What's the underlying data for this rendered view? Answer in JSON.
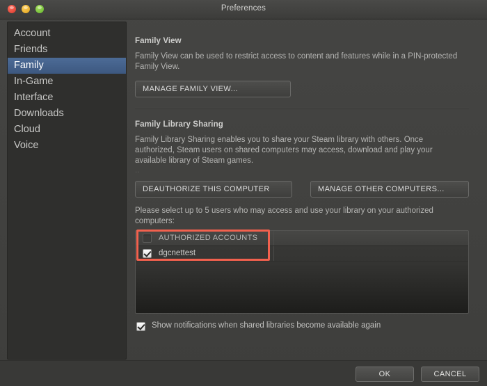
{
  "window": {
    "title": "Preferences",
    "traffic_lights": [
      "close",
      "minimize",
      "maximize"
    ]
  },
  "sidebar": {
    "items": [
      {
        "label": "Account",
        "selected": false
      },
      {
        "label": "Friends",
        "selected": false
      },
      {
        "label": "Family",
        "selected": true
      },
      {
        "label": "In-Game",
        "selected": false
      },
      {
        "label": "Interface",
        "selected": false
      },
      {
        "label": "Downloads",
        "selected": false
      },
      {
        "label": "Cloud",
        "selected": false
      },
      {
        "label": "Voice",
        "selected": false
      }
    ]
  },
  "family_view": {
    "title": "Family View",
    "description": "Family View can be used to restrict access to content and features while in a PIN-protected Family View.",
    "manage_button": "MANAGE FAMILY VIEW..."
  },
  "family_library_sharing": {
    "title": "Family Library Sharing",
    "description": "Family Library Sharing enables you to share your Steam library with others. Once authorized, Steam users on shared computers may access, download and play your available library of Steam games.",
    "extra_line": "..",
    "deauthorize_button": "DEAUTHORIZE THIS COMPUTER",
    "manage_others_button": "MANAGE OTHER COMPUTERS...",
    "select_prompt": "Please select up to 5 users who may access and use your library on your authorized computers:",
    "list": {
      "header": {
        "label": "AUTHORIZED ACCOUNTS",
        "checked": false
      },
      "rows": [
        {
          "label": "dgcnettest",
          "checked": true
        }
      ]
    },
    "notifications_checkbox": {
      "label": "Show notifications when shared libraries become available again",
      "checked": true
    }
  },
  "annotation": {
    "color": "#f2614e"
  },
  "footer": {
    "ok_label": "OK",
    "cancel_label": "CANCEL"
  }
}
